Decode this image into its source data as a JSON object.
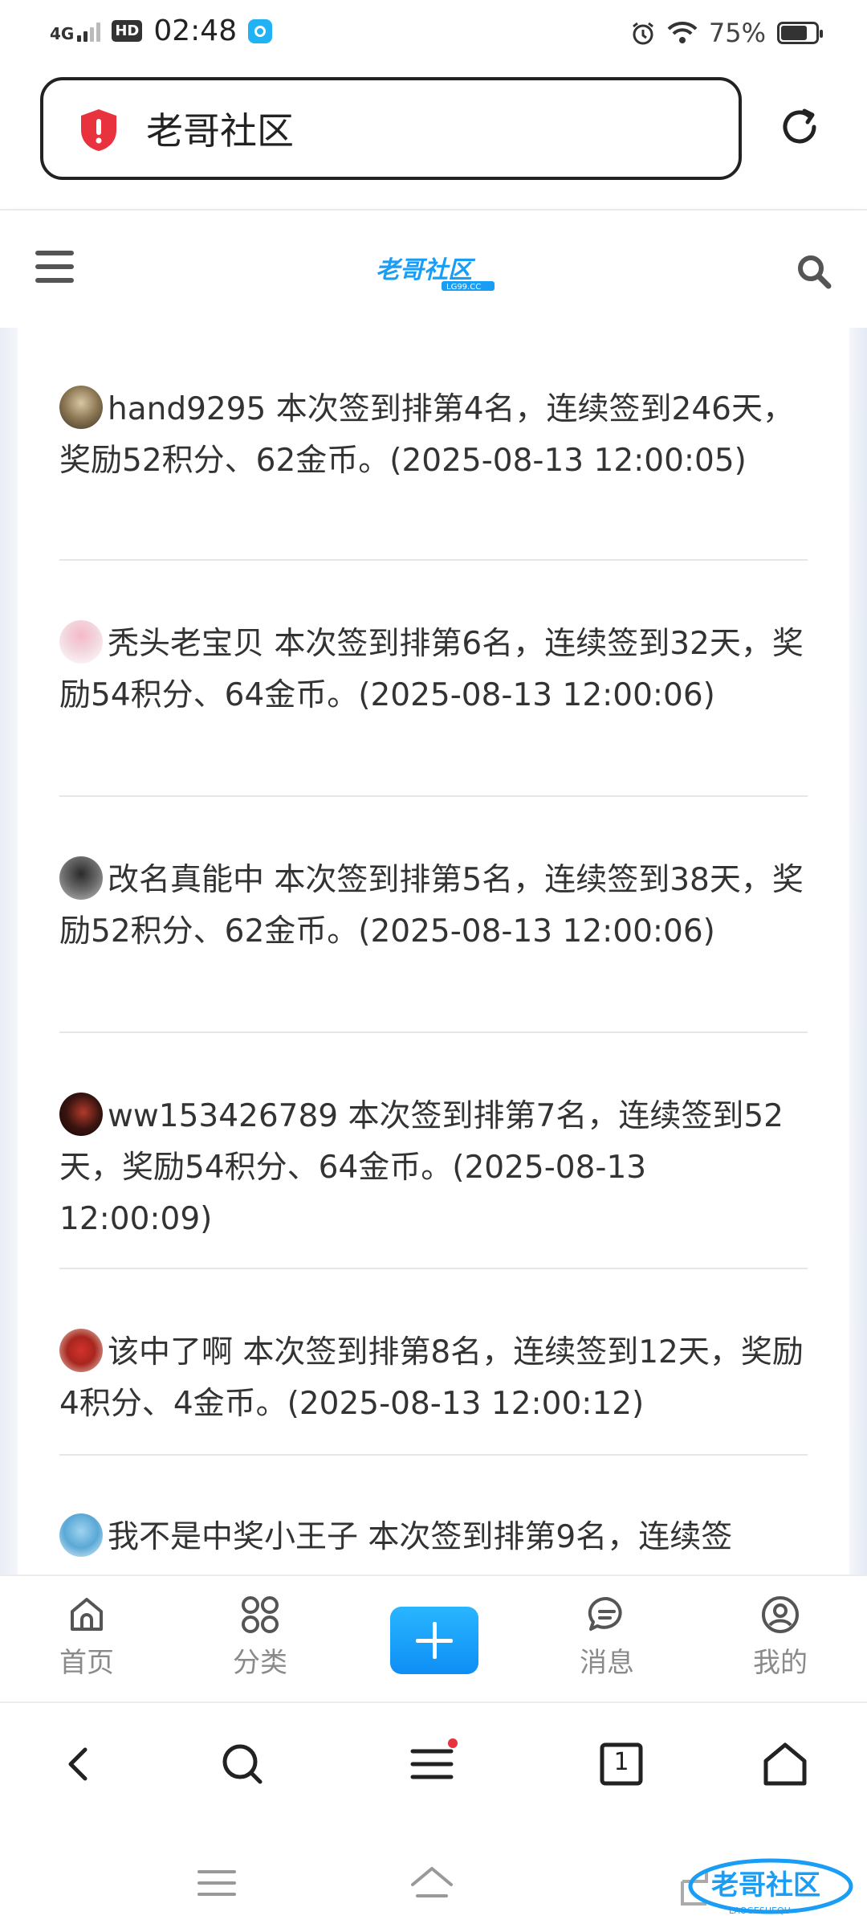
{
  "status_bar": {
    "network": "4G",
    "hd": "HD",
    "time": "02:48",
    "battery_pct": "75%",
    "battery_level": 0.75
  },
  "address_bar": {
    "text": "老哥社区"
  },
  "site": {
    "logo_text": "老哥社区",
    "logo_sub": "LG99.CC"
  },
  "feed": [
    {
      "text": "hand9295 本次签到排第4名，连续签到246天，奖励52积分、62金币。(2025-08-13 12:00:05)"
    },
    {
      "text": "秃头老宝贝 本次签到排第6名，连续签到32天，奖励54积分、64金币。(2025-08-13 12:00:06)"
    },
    {
      "text": "改名真能中 本次签到排第5名，连续签到38天，奖励52积分、62金币。(2025-08-13 12:00:06)"
    },
    {
      "text": "ww153426789 本次签到排第7名，连续签到52天，奖励54积分、64金币。(2025-08-13 12:00:09)"
    },
    {
      "text": "该中了啊 本次签到排第8名，连续签到12天，奖励4积分、4金币。(2025-08-13 12:00:12)"
    },
    {
      "text": "我不是中奖小王子 本次签到排第9名，连续签"
    }
  ],
  "bottom_nav": {
    "home": "首页",
    "category": "分类",
    "messages": "消息",
    "mine": "我的"
  },
  "browser_bar": {
    "tab_count": "1"
  },
  "watermark": {
    "text": "老哥社区",
    "sub": "LAOGESHEQU"
  },
  "colors": {
    "accent": "#1a9df5",
    "shield": "#e8333f",
    "notify_dot": "#e8333f"
  }
}
